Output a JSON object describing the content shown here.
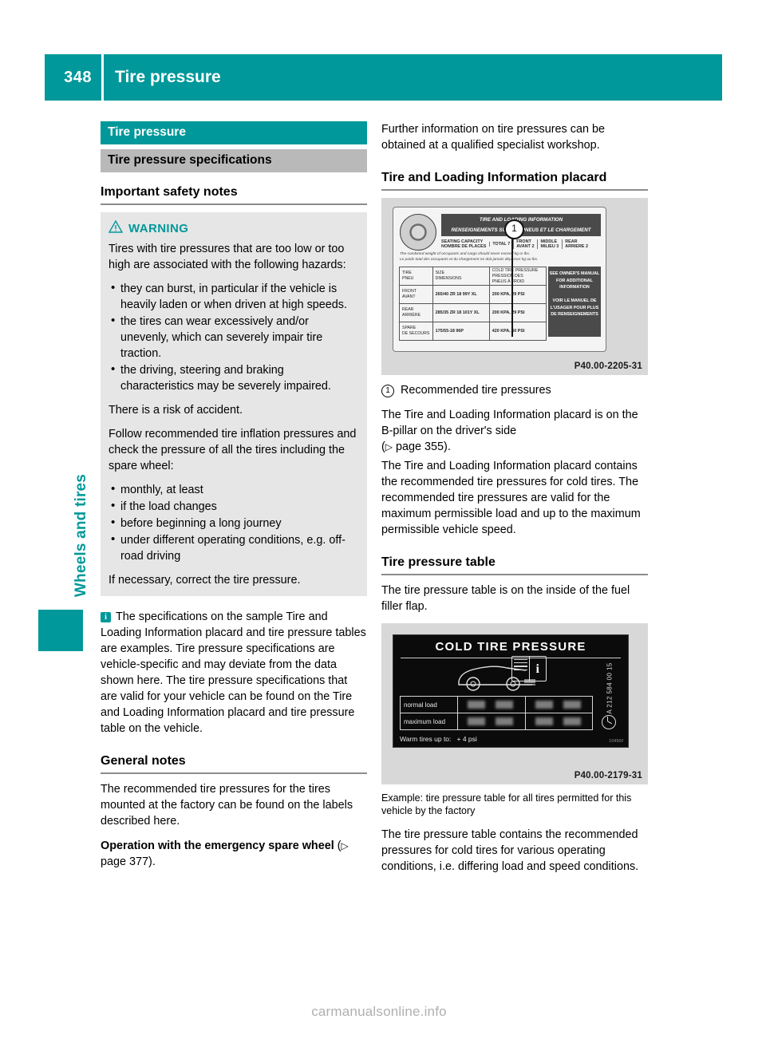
{
  "header": {
    "page_number": "348",
    "title": "Tire pressure",
    "accent_color": "#00989a"
  },
  "side_tab": {
    "chapter_label": "Wheels and tires"
  },
  "left_column": {
    "bar_heading": "Tire pressure",
    "bar_subheading": "Tire pressure specifications",
    "safety_heading": "Important safety notes",
    "warning": {
      "label": "WARNING",
      "icon": "warning-triangle-icon",
      "intro": "Tires with tire pressures that are too low or too high are associated with the following hazards:",
      "hazards": [
        "they can burst, in particular if the vehicle is heavily laden or when driven at high speeds.",
        "the tires can wear excessively and/or unevenly, which can severely impair tire traction.",
        "the driving, steering and braking characteristics may be severely impaired."
      ],
      "risk": "There is a risk of accident.",
      "follow": "Follow recommended tire inflation pressures and check the pressure of all the tires including the spare wheel:",
      "checks": [
        "monthly, at least",
        "if the load changes",
        "before beginning a long journey",
        "under different operating conditions, e.g. off-road driving"
      ],
      "closing": "If necessary, correct the tire pressure."
    },
    "info_note": "The specifications on the sample Tire and Loading Information placard and tire pressure tables are examples. Tire pressure specifications are vehicle-specific and may deviate from the data shown here. The tire pressure specifications that are valid for your vehicle can be found on the Tire and Loading Information placard and tire pressure table on the vehicle.",
    "info_icon_letter": "i",
    "general_heading": "General notes",
    "general_text": "The recommended tire pressures for the tires mounted at the factory can be found on the labels described here.",
    "emergency_spare_bold": "Operation with the emergency spare wheel",
    "emergency_spare_ref": "page 377)."
  },
  "right_column": {
    "intro": "Further information on tire pressures can be obtained at a qualified specialist workshop.",
    "placard_heading": "Tire and Loading Information placard",
    "placard_figure": {
      "code": "P40.00-2205-31",
      "callout_number": "1",
      "title_line1": "TIRE AND LOADING INFORMATION",
      "title_line2": "RENSEIGNEMENTS SUR LES PNEUS ET LE CHARGEMENT",
      "seating_label1": "SEATING CAPACITY",
      "seating_label2": "NOMBRE DE PLACES",
      "seating_total_label": "TOTAL",
      "seating_total_value": "7",
      "seating_front_label1": "FRONT",
      "seating_front_label2": "AVANT",
      "seating_front_value": "2",
      "seating_middle_label1": "MIDDLE",
      "seating_middle_label2": "MILIEU",
      "seating_middle_value": "3",
      "seating_rear_label1": "REAR",
      "seating_rear_label2": "ARRIERE",
      "seating_rear_value": "2",
      "weight_note_en": "The combined weight of occupants and cargo should never exceed        kg or        lbs.",
      "weight_note_fr": "Le poids total des occupants et du chargement ne doit jamais dépasser        kg ou        lbs.",
      "table": {
        "headers": [
          "TIRE\nPNEU",
          "SIZE\nDIMENSIONS",
          "COLD TIRE PRESSURE\nPRESSION DES PNEUS À FROID"
        ],
        "rows": [
          {
            "tire_en": "FRONT",
            "tire_fr": "AVANT",
            "size": "265/40 ZR 18 99Y XL",
            "pressure": "200 KPA, 29 PSI"
          },
          {
            "tire_en": "REAR",
            "tire_fr": "ARRIÈRE",
            "size": "285/35 ZR 18 101Y XL",
            "pressure": "200 KPA, 29 PSI"
          },
          {
            "tire_en": "SPARE",
            "tire_fr": "DE SECOURS",
            "size": "175/55-18 96P",
            "pressure": "420 KPA, 60 PSI"
          }
        ]
      },
      "owner_note_en": "SEE OWNER'S MANUAL FOR ADDITIONAL INFORMATION",
      "owner_note_fr": "VOIR LE MANUEL DE L'USAGER POUR PLUS DE RENSEIGNEMENTS"
    },
    "callout_text": "Recommended tire pressures",
    "placard_location": "The Tire and Loading Information placard is on the B-pillar on the driver's side",
    "placard_location_ref": "page 355).",
    "placard_contents": "The Tire and Loading Information placard contains the recommended tire pressures for cold tires. The recommended tire pressures are valid for the maximum permissible load and up to the maximum permissible vehicle speed.",
    "table_heading": "Tire pressure table",
    "table_location": "The tire pressure table is on the inside of the fuel filler flap.",
    "cold_figure": {
      "code": "P40.00-2179-31",
      "title": "COLD TIRE PRESSURE",
      "row_labels": [
        "normal load",
        "maximum load"
      ],
      "warm_note": "Warm tires up to:",
      "warm_value": "+ 4 psi",
      "side_part_number": "A 212 584 00 15",
      "corner_code": "10456F"
    },
    "cold_caption": "Example: tire pressure table for all tires permitted for this vehicle by the factory",
    "cold_body": "The tire pressure table contains the recommended pressures for cold tires for various operating conditions, i.e. differing load and speed conditions."
  },
  "footer": {
    "url": "carmanualsonline.info"
  }
}
